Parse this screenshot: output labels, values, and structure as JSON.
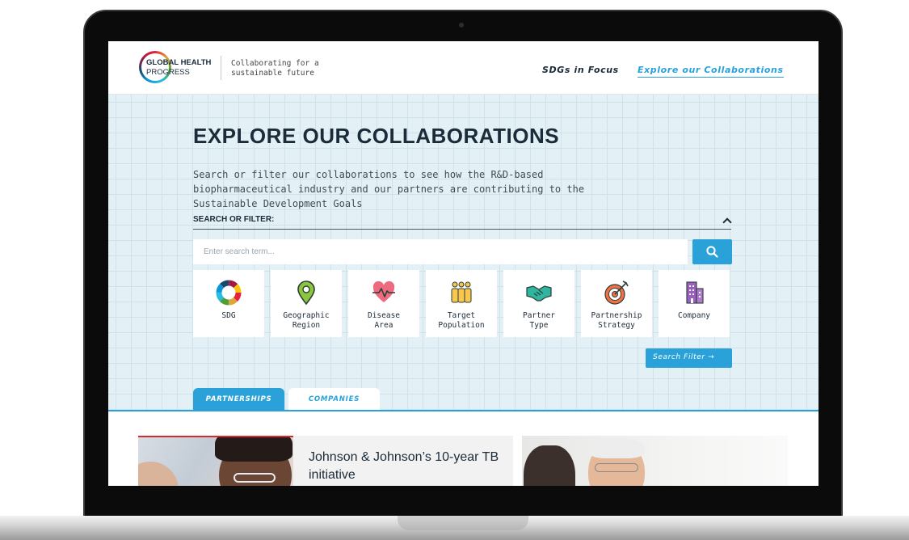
{
  "header": {
    "logo": {
      "line1": "GLOBAL HEALTH",
      "line2": "PROGRESS"
    },
    "tagline": "Collaborating for a\nsustainable future",
    "nav": [
      {
        "label": "SDGs in Focus"
      },
      {
        "label": "Explore our Collaborations",
        "active": true
      }
    ]
  },
  "hero": {
    "title": "EXPLORE OUR COLLABORATIONS",
    "description": "Search or filter our collaborations to see how the R&D-based biopharmaceutical industry and our partners are contributing to the Sustainable Development Goals",
    "filter_label": "SEARCH OR FILTER:",
    "search": {
      "placeholder": "Enter search term...",
      "value": ""
    },
    "filters": [
      {
        "label": "SDG",
        "icon": "sdg-wheel-icon"
      },
      {
        "label": "Geographic\nRegion",
        "icon": "map-pin-icon"
      },
      {
        "label": "Disease\nArea",
        "icon": "heartbeat-icon"
      },
      {
        "label": "Target\nPopulation",
        "icon": "people-group-icon"
      },
      {
        "label": "Partner\nType",
        "icon": "handshake-icon"
      },
      {
        "label": "Partnership\nStrategy",
        "icon": "target-icon"
      },
      {
        "label": "Company",
        "icon": "building-icon"
      }
    ],
    "search_filter_button": "Search Filter →"
  },
  "tabs": [
    {
      "label": "Partnerships",
      "active": true
    },
    {
      "label": "Companies",
      "active": false
    }
  ],
  "cards": [
    {
      "title": "Johnson & Johnson’s 10-year TB initiative"
    }
  ],
  "colors": {
    "accent": "#2aa2d9",
    "heading": "#1c2b39",
    "hero_bg": "#e3f0f5"
  }
}
